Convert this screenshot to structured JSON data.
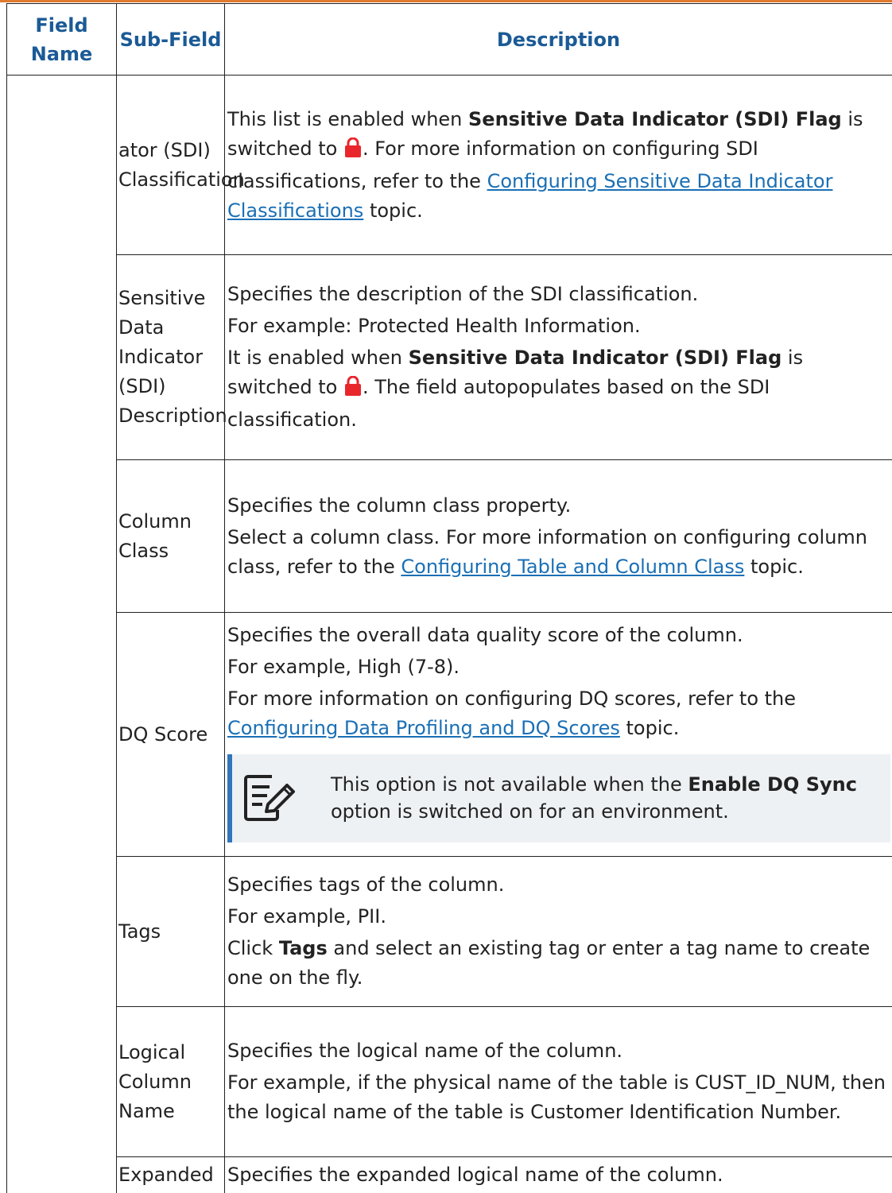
{
  "headers": {
    "field_name": "Field Name",
    "sub_field": "Sub-Field",
    "description": "Description"
  },
  "rows": {
    "sdi_classification": {
      "sub_field": "ator (SDI) Classification",
      "text_1": "This list is enabled when ",
      "bold_1": "Sensitive Data Indicator (SDI) Flag",
      "text_2": " is switched to ",
      "text_3": ". For more information on configuring SDI classifications, refer to the ",
      "link": "Configuring Sensitive Data Indicator Classifications",
      "text_4": " topic."
    },
    "sdi_description": {
      "sub_field": "Sensitive Data Indicator (SDI) Description",
      "p1": "Specifies the description of the SDI classification.",
      "p2": "For example: Protected Health Information.",
      "text_1": "It is enabled when ",
      "bold_1": "Sensitive Data Indicator (SDI) Flag",
      "text_2": " is switched to ",
      "text_3": ". The field autopopulates based on the SDI classification."
    },
    "column_class": {
      "sub_field": "Column Class",
      "p1": "Specifies the column class property.",
      "text_1": "Select a column class. For more information on configuring column class, refer to the ",
      "link": "Configuring Table and Column Class",
      "text_2": " topic."
    },
    "dq_score": {
      "sub_field": "DQ Score",
      "p1": "Specifies the overall data quality score of the column.",
      "p2": "For example, High (7-8).",
      "text_1": "For more information on configuring DQ scores, refer to the ",
      "link": "Configuring Data Profiling and DQ Scores",
      "text_2": " topic.",
      "note": {
        "icon": "note-edit-icon",
        "text_1": "This option is not available when the ",
        "bold_1": "Enable DQ Sync",
        "text_2": " option is switched on for an environment."
      }
    },
    "tags": {
      "sub_field": "Tags",
      "p1": "Specifies tags of the column.",
      "p2": "For example, PII.",
      "text_1": "Click ",
      "bold_1": "Tags",
      "text_2": " and select an existing tag or enter a tag name to create one on the fly."
    },
    "logical_column_name": {
      "sub_field": "Logical Column Name",
      "p1": "Specifies the logical name of the column.",
      "p2": "For example, if the physical name of the table is CUST_ID_NUM, then the logical name of the table is Customer Identification Number."
    },
    "expanded": {
      "sub_field": "Expanded",
      "p1": "Specifies the expanded logical name of the column."
    }
  },
  "icons": {
    "lock": "lock-icon",
    "lock_color": "#e8262c"
  },
  "colors": {
    "header_text": "#1b5a96",
    "link": "#1a6fb5",
    "note_bar": "#2f76bb",
    "note_bg": "#eef1f4",
    "top_rule": "#e07a2e"
  }
}
